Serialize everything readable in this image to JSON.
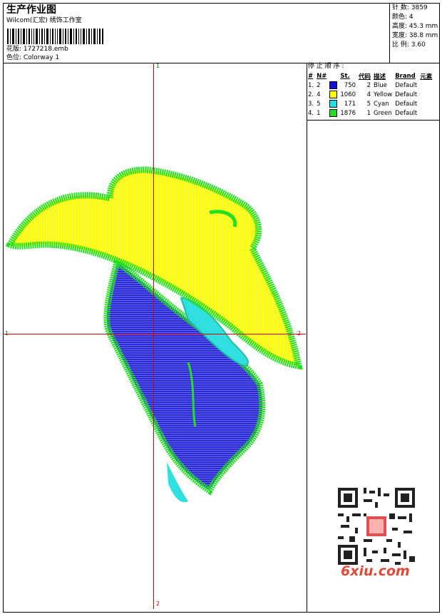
{
  "header": {
    "title": "生产作业图",
    "company": "Wilcom(汇宏) 绣饰工作室",
    "design_label": "花版: 1727218.emb",
    "colorway_label": "色位: Colorway 1"
  },
  "stats": {
    "stitches": "针 数: 3859",
    "colors": "颜色: 4",
    "height": "高度: 45.3 mm",
    "width": "宽度: 38.8 mm",
    "scale": "比 例: 3.60"
  },
  "axes": {
    "top": "1",
    "left": "1",
    "right": "2",
    "bottom": "2"
  },
  "stop_sequence": {
    "title": "停 止 顺 序 :",
    "headers": [
      "#",
      "N#",
      "St.",
      "代码",
      "描述",
      "Brand",
      "元素"
    ],
    "rows": [
      {
        "idx": "1.",
        "n": "2",
        "color": "#1010e0",
        "st": "750",
        "code": "2",
        "desc": "Blue",
        "brand": "Default"
      },
      {
        "idx": "2.",
        "n": "4",
        "color": "#ffff00",
        "st": "1060",
        "code": "4",
        "desc": "Yellow",
        "brand": "Default"
      },
      {
        "idx": "3.",
        "n": "5",
        "color": "#20e0e0",
        "st": "171",
        "code": "5",
        "desc": "Cyan",
        "brand": "Default"
      },
      {
        "idx": "4.",
        "n": "1",
        "color": "#20e020",
        "st": "1876",
        "code": "1",
        "desc": "Green",
        "brand": "Default"
      }
    ]
  },
  "watermark": {
    "logo_text": "6xiu.com"
  }
}
